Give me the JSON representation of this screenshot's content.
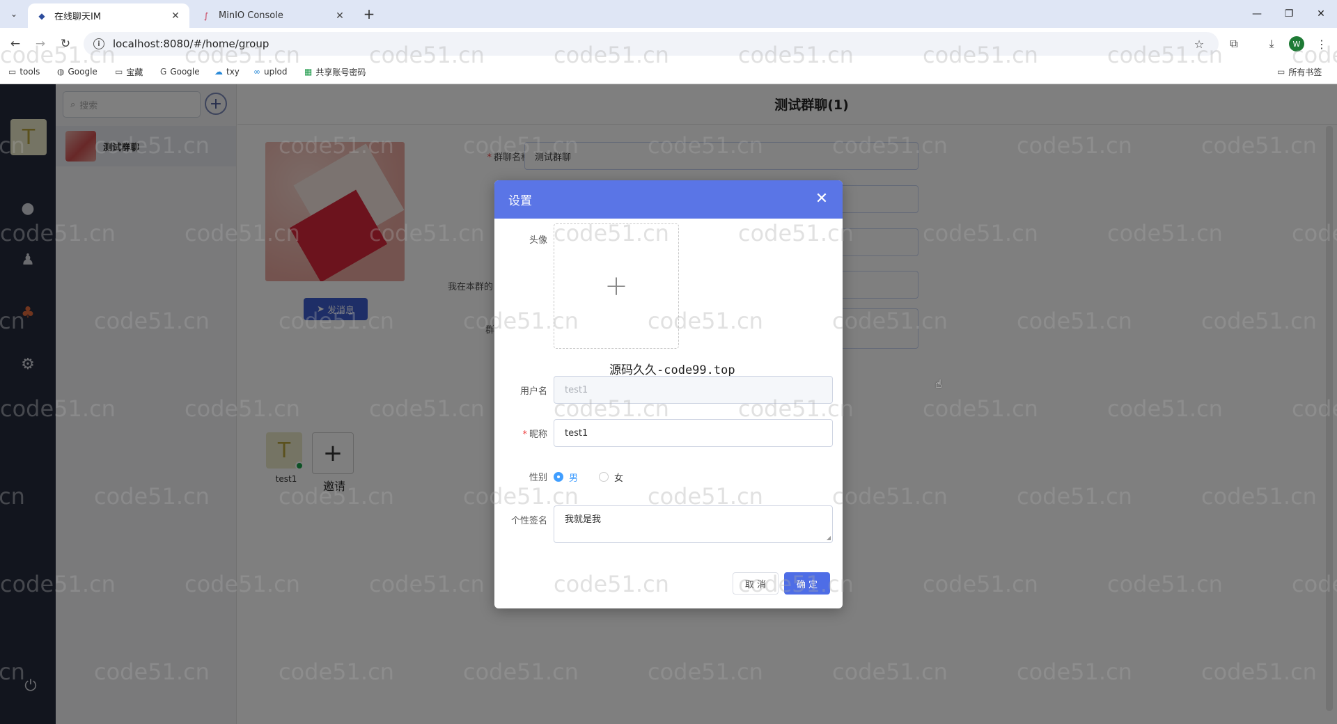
{
  "browser": {
    "tabs": [
      {
        "title": "在线聊天IM",
        "active": true,
        "icon": "app-favicon"
      },
      {
        "title": "MinIO Console",
        "active": false,
        "icon": "minio-favicon"
      }
    ],
    "url": "localhost:8080/#/home/group",
    "bookmarks": [
      {
        "label": "tools",
        "icon": "folder-icon"
      },
      {
        "label": "Google",
        "icon": "globe-icon"
      },
      {
        "label": "宝藏",
        "icon": "folder-icon"
      },
      {
        "label": "Google",
        "icon": "google-icon"
      },
      {
        "label": "txy",
        "icon": "cloud-icon"
      },
      {
        "label": "uplod",
        "icon": "link-icon"
      },
      {
        "label": "共享账号密码",
        "icon": "sheet-icon"
      }
    ],
    "all_bookmarks": "所有书签",
    "profile_initial": "W"
  },
  "sidebar": {
    "user_initial": "T",
    "search_placeholder": "搜索",
    "groups": [
      {
        "name": "测试群聊"
      }
    ]
  },
  "main": {
    "title": "测试群聊(1)",
    "send_button": "发消息",
    "form": {
      "group_name_label": "群聊名称",
      "group_name_value": "测试群聊",
      "my_nickname_label": "我在本群的",
      "notice_label": "群"
    },
    "members": [
      {
        "name": "test1",
        "initial": "T",
        "online": true
      }
    ],
    "invite_label": "邀请"
  },
  "dialog": {
    "title": "设置",
    "avatar_label": "头像",
    "watermark_text": "源码久久-code99.top",
    "username_label": "用户名",
    "username_value": "test1",
    "nickname_label": "昵称",
    "nickname_value": "test1",
    "gender_label": "性别",
    "gender_options": [
      "男",
      "女"
    ],
    "gender_selected": "男",
    "signature_label": "个性签名",
    "signature_value": "我就是我",
    "cancel": "取 消",
    "confirm": "确 定"
  },
  "watermark": "code51.cn",
  "colors": {
    "accent": "#5a75e6",
    "primary_button": "#4e6de6",
    "nav_bg": "#252a3d",
    "online": "#1aa34a"
  }
}
